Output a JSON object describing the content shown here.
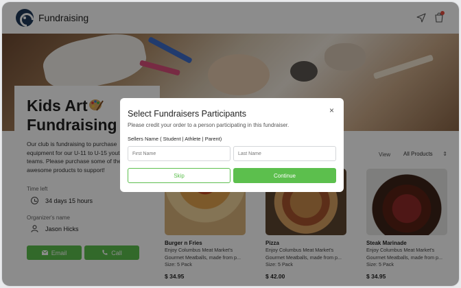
{
  "header": {
    "app_title": "Fundraising"
  },
  "hero": {
    "image_name": "kids-art-supplies-photo"
  },
  "info": {
    "title": "Kids Art Fundraising",
    "title_icon": "palette-icon",
    "description": "Our club is fundraising to purchase\nequipment for our U-11 to U-15 youth\nteams. Please purchase some of the\nawesome products to support!",
    "time_left_label": "Time left",
    "time_left_value": "34 days 15 hours",
    "organizer_label": "Organizer's name",
    "organizer_value": "Jason Hicks",
    "email_label": "Email",
    "call_label": "Call"
  },
  "filter": {
    "view_label": "View",
    "view_value": "All Products"
  },
  "products": [
    {
      "name": "Burger n Fries",
      "desc": "Enjoy Columbus Meat Market's\nGourmet Meatballs, made from p...",
      "size": "Size: 5 Pack",
      "price": "$ 34.95"
    },
    {
      "name": "Pizza",
      "desc": "Enjoy Columbus Meat Market's\nGourmet Meatballs, made from p...",
      "size": "Size: 5 Pack",
      "price": "$ 42.00"
    },
    {
      "name": "Steak Marinade",
      "desc": "Enjoy Columbus Meat Market's\nGourmet Meatballs, made from p...",
      "size": "Size: 5 Pack",
      "price": "$ 34.95"
    }
  ],
  "modal": {
    "title": "Select Fundraisers Participants",
    "close": "×",
    "subtitle": "Please credit your order to a person participating in this fundraiser.",
    "sellers_label": "Sellers Name ( Student | Athlete | Parent)",
    "first_name_placeholder": "First Name",
    "last_name_placeholder": "Last Name",
    "skip_label": "Skip",
    "continue_label": "Continue"
  },
  "colors": {
    "accent": "#5cbf4d",
    "brand": "#1f3a5a",
    "badge": "#e54b3c"
  }
}
